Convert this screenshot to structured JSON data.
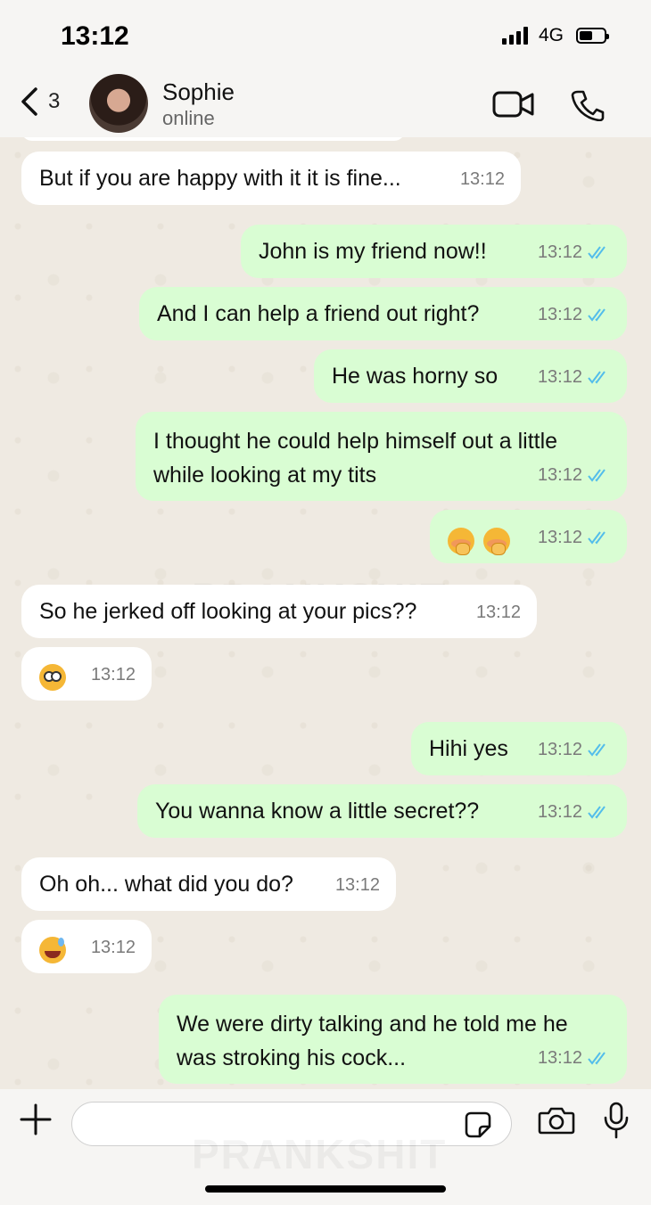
{
  "status_bar": {
    "time": "13:12",
    "network": "4G"
  },
  "header": {
    "back_count": "3",
    "contact_name": "Sophie",
    "contact_status": "online",
    "icons": [
      "back-chevron-icon",
      "video-call-icon",
      "phone-call-icon"
    ]
  },
  "watermark": "PRANKSHIT",
  "messages": [
    {
      "dir": "in",
      "text": "But if you are happy with it it is fine...",
      "time": "13:12"
    },
    {
      "dir": "out",
      "text": "John is my friend now!!",
      "time": "13:12",
      "read": true
    },
    {
      "dir": "out",
      "text": "And I can help a friend out right?",
      "time": "13:12",
      "read": true
    },
    {
      "dir": "out",
      "text": "He was horny so",
      "time": "13:12",
      "read": true
    },
    {
      "dir": "out",
      "text": "I thought he could help himself out a little while looking at my tits",
      "line1": "I thought he could help himself out a little",
      "line2": "while looking at my tits",
      "time": "13:12",
      "read": true
    },
    {
      "dir": "out",
      "emoji": [
        "face-with-hand-over-mouth",
        "face-with-hand-over-mouth"
      ],
      "time": "13:12",
      "read": true
    },
    {
      "dir": "in",
      "text": "So he jerked off looking at your pics??",
      "time": "13:12"
    },
    {
      "dir": "in",
      "emoji": [
        "flushed-face"
      ],
      "time": "13:12"
    },
    {
      "dir": "out",
      "text": "Hihi yes",
      "time": "13:12",
      "read": true
    },
    {
      "dir": "out",
      "text": "You wanna know a little secret??",
      "time": "13:12",
      "read": true
    },
    {
      "dir": "in",
      "text": "Oh oh... what did you do?",
      "time": "13:12"
    },
    {
      "dir": "in",
      "emoji": [
        "grinning-face-with-sweat"
      ],
      "time": "13:12"
    },
    {
      "dir": "out",
      "text": "We were dirty talking and he told me he was stroking his cock...",
      "line1": "We were dirty talking and he told me he",
      "line2": "was stroking his cock...",
      "time": "13:12",
      "read": true
    }
  ],
  "input": {
    "placeholder": ""
  },
  "colors": {
    "incoming": "#ffffff",
    "outgoing": "#d9fdd3",
    "tick": "#53bdeb",
    "background": "#efeae2"
  }
}
